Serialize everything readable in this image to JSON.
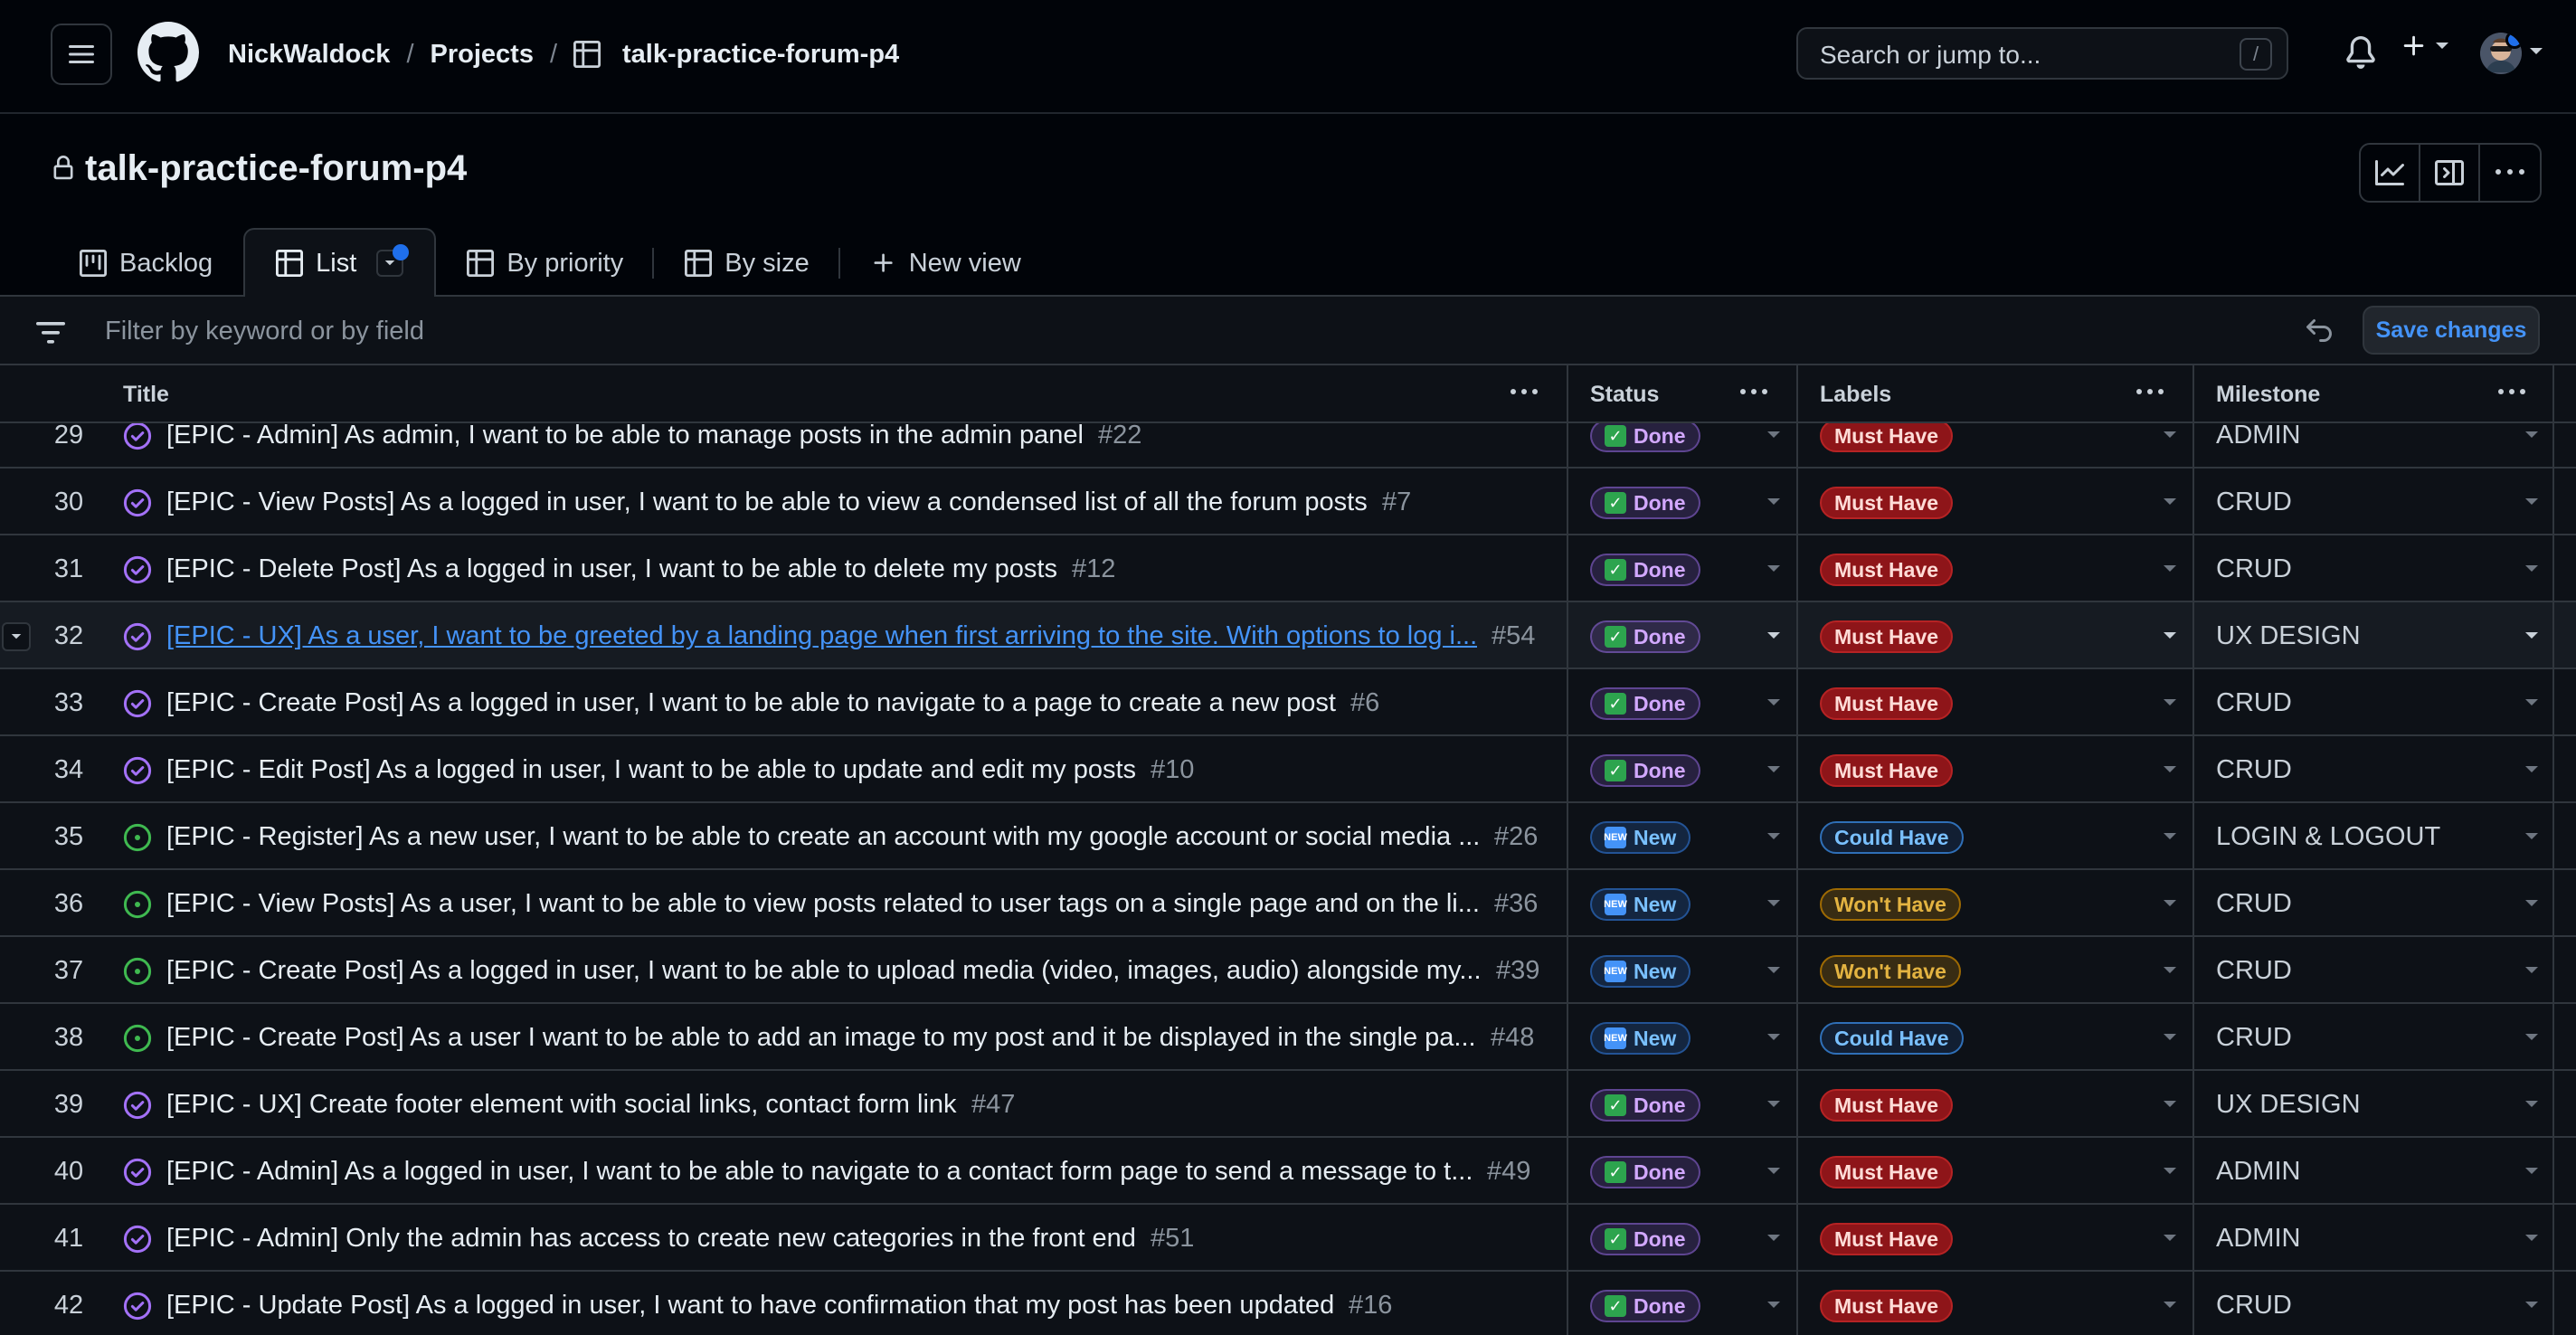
{
  "header": {
    "breadcrumbs": [
      "NickWaldock",
      "Projects",
      "talk-practice-forum-p4"
    ],
    "search_placeholder": "Search or jump to...",
    "search_shortcut": "/"
  },
  "project": {
    "title": "talk-practice-forum-p4"
  },
  "tabs": [
    {
      "label": "Backlog",
      "icon": "board-icon"
    },
    {
      "label": "List",
      "icon": "table-icon",
      "active": true
    },
    {
      "label": "By priority",
      "icon": "table-icon"
    },
    {
      "label": "By size",
      "icon": "table-icon"
    },
    {
      "label": "New view",
      "icon": "plus-icon"
    }
  ],
  "filter": {
    "placeholder": "Filter by keyword or by field",
    "save_label": "Save changes"
  },
  "columns": {
    "title": "Title",
    "status": "Status",
    "labels": "Labels",
    "milestone": "Milestone"
  },
  "colors": {
    "done": "#a371f7",
    "new": "#3fb950",
    "must_have": "#b62324",
    "could_have": "#2f6fb7",
    "wont_have": "#9e6a03",
    "link": "#4493f8"
  },
  "rows": [
    {
      "num": "29",
      "state": "done",
      "title": "[EPIC - Admin] As admin, I want to be able to manage posts in the admin panel",
      "issue": "#22",
      "status": "Done",
      "label": "Must Have",
      "milestone": "ADMIN"
    },
    {
      "num": "30",
      "state": "done",
      "title": "[EPIC - View Posts] As a logged in user, I want to be able to view a condensed list of all the forum posts",
      "issue": "#7",
      "status": "Done",
      "label": "Must Have",
      "milestone": "CRUD"
    },
    {
      "num": "31",
      "state": "done",
      "title": "[EPIC - Delete Post] As a logged in user, I want to be able to delete my posts",
      "issue": "#12",
      "status": "Done",
      "label": "Must Have",
      "milestone": "CRUD"
    },
    {
      "num": "32",
      "state": "done",
      "title": "[EPIC - UX] As a user, I want to be greeted by a landing page when first arriving to the site. With options to log i...",
      "issue": "#54",
      "status": "Done",
      "label": "Must Have",
      "milestone": "UX DESIGN",
      "highlight": true
    },
    {
      "num": "33",
      "state": "done",
      "title": "[EPIC - Create Post] As a logged in user, I want to be able to navigate to a page to create a new post",
      "issue": "#6",
      "status": "Done",
      "label": "Must Have",
      "milestone": "CRUD"
    },
    {
      "num": "34",
      "state": "done",
      "title": "[EPIC - Edit Post] As a logged in user, I want to be able to update and edit my posts",
      "issue": "#10",
      "status": "Done",
      "label": "Must Have",
      "milestone": "CRUD"
    },
    {
      "num": "35",
      "state": "open",
      "title": "[EPIC - Register] As a new user, I want to be able to create an account with my google account or social media ...",
      "issue": "#26",
      "status": "New",
      "label": "Could Have",
      "milestone": "LOGIN & LOGOUT"
    },
    {
      "num": "36",
      "state": "open",
      "title": "[EPIC - View Posts] As a user, I want to be able to view posts related to user tags on a single page and on the li...",
      "issue": "#36",
      "status": "New",
      "label": "Won't Have",
      "milestone": "CRUD"
    },
    {
      "num": "37",
      "state": "open",
      "title": "[EPIC - Create Post] As a logged in user, I want to be able to upload media (video, images, audio) alongside my...",
      "issue": "#39",
      "status": "New",
      "label": "Won't Have",
      "milestone": "CRUD"
    },
    {
      "num": "38",
      "state": "open",
      "title": "[EPIC - Create Post] As a user I want to be able to add an image to my post and it be displayed in the single pa...",
      "issue": "#48",
      "status": "New",
      "label": "Could Have",
      "milestone": "CRUD"
    },
    {
      "num": "39",
      "state": "done",
      "title": "[EPIC - UX] Create footer element with social links, contact form link",
      "issue": "#47",
      "status": "Done",
      "label": "Must Have",
      "milestone": "UX DESIGN"
    },
    {
      "num": "40",
      "state": "done",
      "title": "[EPIC - Admin] As a logged in user, I want to be able to navigate to a contact form page to send a message to t...",
      "issue": "#49",
      "status": "Done",
      "label": "Must Have",
      "milestone": "ADMIN"
    },
    {
      "num": "41",
      "state": "done",
      "title": "[EPIC - Admin] Only the admin has access to create new categories in the front end",
      "issue": "#51",
      "status": "Done",
      "label": "Must Have",
      "milestone": "ADMIN"
    },
    {
      "num": "42",
      "state": "done",
      "title": "[EPIC - Update Post] As a logged in user, I want to have confirmation that my post has been updated",
      "issue": "#16",
      "status": "Done",
      "label": "Must Have",
      "milestone": "CRUD"
    }
  ]
}
